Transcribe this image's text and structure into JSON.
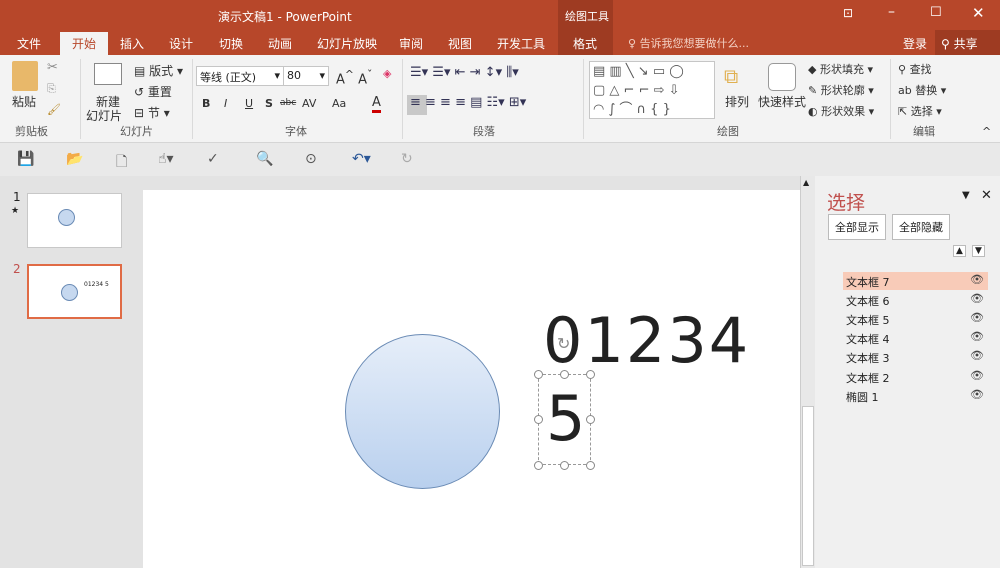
{
  "title": "演示文稿1 - PowerPoint",
  "context_tab_group": "绘图工具",
  "window_controls": [
    "restore-ribbon",
    "minimize",
    "maximize",
    "close"
  ],
  "tabs": [
    "文件",
    "开始",
    "插入",
    "设计",
    "切换",
    "动画",
    "幻灯片放映",
    "审阅",
    "视图",
    "开发工具",
    "格式"
  ],
  "tell_me": "告诉我您想要做什么...",
  "signin": "登录",
  "share": "共享",
  "ribbon": {
    "clipboard": {
      "paste": "粘贴",
      "label": "剪贴板"
    },
    "slides": {
      "new_slide_1": "新建",
      "new_slide_2": "幻灯片",
      "layout": "版式",
      "reset": "重置",
      "section": "节",
      "label": "幻灯片"
    },
    "font": {
      "name": "等线 (正文)",
      "size": "80",
      "label": "字体",
      "buttons": [
        "B",
        "I",
        "U",
        "S",
        "abc",
        "AV",
        "Aa",
        "A"
      ]
    },
    "paragraph": {
      "label": "段落"
    },
    "drawing": {
      "arrange": "排列",
      "quick_styles": "快速样式",
      "fill": "形状填充",
      "outline": "形状轮廓",
      "effects": "形状效果",
      "label": "绘图"
    },
    "editing": {
      "find": "查找",
      "replace": "替换",
      "select": "选择",
      "label": "编辑"
    }
  },
  "thumbnails": [
    {
      "num": "1",
      "star": "★"
    },
    {
      "num": "2",
      "text": "01234 5"
    }
  ],
  "slide": {
    "line1": "01234",
    "line2": "5"
  },
  "selection_pane": {
    "title": "选择",
    "show_all": "全部显示",
    "hide_all": "全部隐藏",
    "items": [
      "文本框 7",
      "文本框 6",
      "文本框 5",
      "文本框 4",
      "文本框 3",
      "文本框 2",
      "椭圆 1"
    ],
    "selected_index": 0
  },
  "colors": {
    "accent": "#b7472a",
    "selected_item": "#f8cbb8"
  }
}
